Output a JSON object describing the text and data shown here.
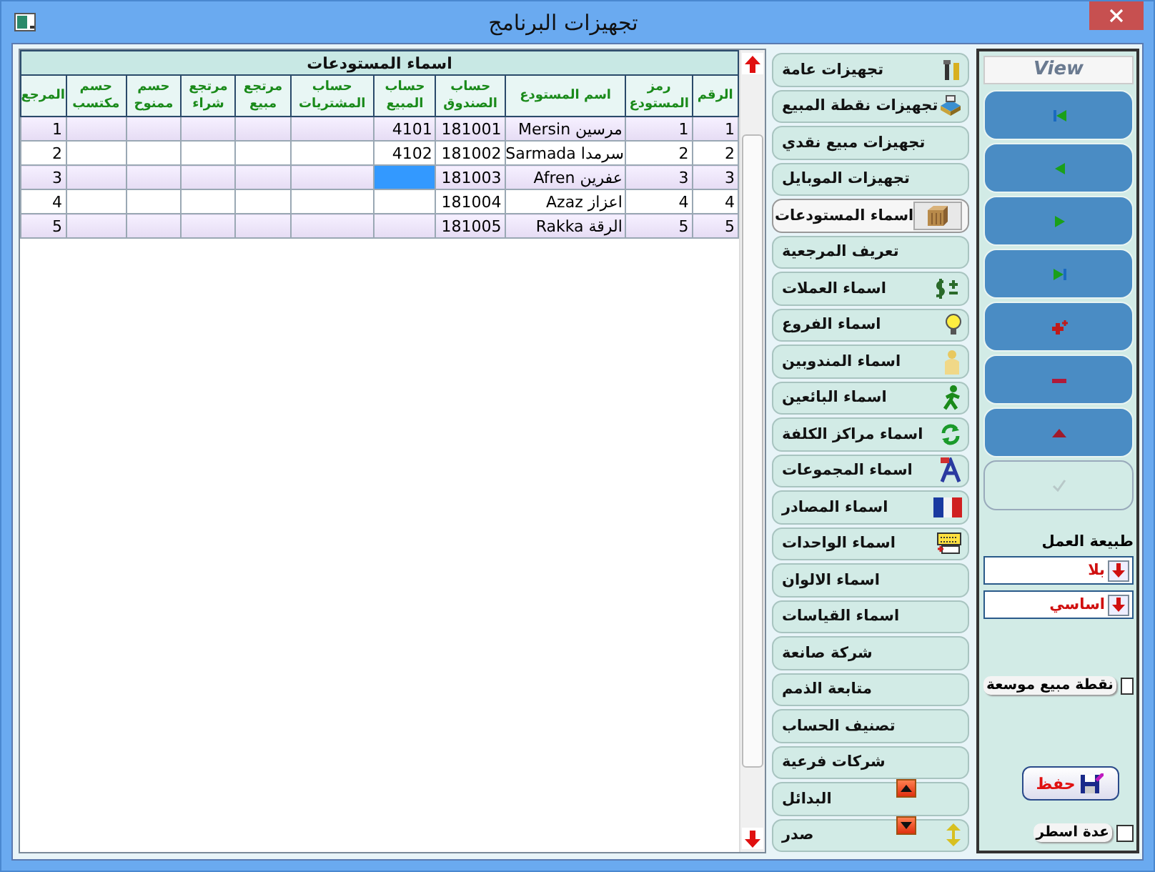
{
  "window": {
    "title": "تجهيزات البرنامج"
  },
  "table": {
    "title": "اسماء المستودعات",
    "columns": [
      "الرقم",
      "رمز المستودع",
      "اسم المستودع",
      "حساب الصندوق",
      "حساب المبيع",
      "حساب المشتريات",
      "مرتجع مبيع",
      "مرتجع شراء",
      "حسم ممنوح",
      "حسم مكتسب",
      "المرجع"
    ],
    "rows": [
      {
        "cells": [
          {
            "text": "1",
            "selected": false
          },
          {
            "text": "1",
            "selected": false
          },
          {
            "text": "مرسين Mersin",
            "selected": false
          },
          {
            "text": "181001",
            "selected": false
          },
          {
            "text": "4101",
            "selected": false
          },
          {
            "selected": false
          },
          {
            "selected": false
          },
          {
            "selected": false
          },
          {
            "selected": false
          },
          {
            "selected": false
          },
          {
            "text": "1",
            "selected": false
          }
        ]
      },
      {
        "cells": [
          {
            "text": "2",
            "selected": false
          },
          {
            "text": "2",
            "selected": false
          },
          {
            "text": "سرمدا Sarmada",
            "selected": false
          },
          {
            "text": "181002",
            "selected": false
          },
          {
            "text": "4102",
            "selected": false
          },
          {
            "selected": false
          },
          {
            "selected": false
          },
          {
            "selected": false
          },
          {
            "selected": false
          },
          {
            "selected": false
          },
          {
            "text": "2",
            "selected": false
          }
        ]
      },
      {
        "cells": [
          {
            "text": "3",
            "selected": false
          },
          {
            "text": "3",
            "selected": false
          },
          {
            "text": "عفرين Afren",
            "selected": false
          },
          {
            "text": "181003",
            "selected": false
          },
          {
            "selected": true
          },
          {
            "selected": false
          },
          {
            "selected": false
          },
          {
            "selected": false
          },
          {
            "selected": false
          },
          {
            "selected": false
          },
          {
            "text": "3",
            "selected": false
          }
        ]
      },
      {
        "cells": [
          {
            "text": "4",
            "selected": false
          },
          {
            "text": "4",
            "selected": false
          },
          {
            "text": "اعزاز Azaz",
            "selected": false
          },
          {
            "text": "181004",
            "selected": false
          },
          {
            "selected": false
          },
          {
            "selected": false
          },
          {
            "selected": false
          },
          {
            "selected": false
          },
          {
            "selected": false
          },
          {
            "selected": false
          },
          {
            "text": "4",
            "selected": false
          }
        ]
      },
      {
        "cells": [
          {
            "text": "5",
            "selected": false
          },
          {
            "text": "5",
            "selected": false
          },
          {
            "text": "الرقة Rakka",
            "selected": false
          },
          {
            "text": "181005",
            "selected": false
          },
          {
            "selected": false
          },
          {
            "selected": false
          },
          {
            "selected": false
          },
          {
            "selected": false
          },
          {
            "selected": false
          },
          {
            "selected": false
          },
          {
            "text": "5",
            "selected": false
          }
        ]
      }
    ]
  },
  "menu": {
    "items": [
      {
        "label": "تجهيزات عامة",
        "kind": "tools",
        "selected": false
      },
      {
        "label": "تجهيزات نقطة المبيع",
        "kind": "register",
        "selected": false
      },
      {
        "label": "تجهيزات مبيع نقدي",
        "kind": "plain",
        "selected": false
      },
      {
        "label": "تجهيزات الموبايل",
        "kind": "plain",
        "selected": false
      },
      {
        "label": "اسماء المستودعات",
        "kind": "box",
        "selected": true
      },
      {
        "label": "تعريف المرجعية",
        "kind": "plain",
        "selected": false
      },
      {
        "label": "اسماء العملات",
        "kind": "money",
        "selected": false
      },
      {
        "label": "اسماء الفروع",
        "kind": "bulb",
        "selected": false
      },
      {
        "label": "اسماء المندوبين",
        "kind": "person",
        "selected": false
      },
      {
        "label": "اسماء البائعين",
        "kind": "runner",
        "selected": false
      },
      {
        "label": "اسماء مراكز الكلفة",
        "kind": "refresh",
        "selected": false
      },
      {
        "label": "اسماء المجموعات",
        "kind": "font",
        "selected": false
      },
      {
        "label": "اسماء المصادر",
        "kind": "flag",
        "selected": false
      },
      {
        "label": "اسماء الواحدات",
        "kind": "keyboard",
        "selected": false
      },
      {
        "label": "اسماء الالوان",
        "kind": "plain",
        "selected": false
      },
      {
        "label": "اسماء القياسات",
        "kind": "plain",
        "selected": false
      },
      {
        "label": "شركة صانعة",
        "kind": "plain",
        "selected": false
      },
      {
        "label": "متابعة الذمم",
        "kind": "plain",
        "selected": false
      },
      {
        "label": "تصنيف الحساب",
        "kind": "plain",
        "selected": false
      },
      {
        "label": "شركات فرعية",
        "kind": "plain",
        "selected": false
      },
      {
        "label": "البدائل",
        "kind": "plain",
        "selected": false
      },
      {
        "label": "صدر",
        "kind": "arrows",
        "selected": false
      }
    ]
  },
  "panel": {
    "header": "View",
    "nav_buttons": [
      {
        "kind": "first",
        "disabled": false
      },
      {
        "kind": "prev",
        "disabled": false
      },
      {
        "kind": "next",
        "disabled": false
      },
      {
        "kind": "last",
        "disabled": false
      },
      {
        "kind": "add",
        "disabled": false
      },
      {
        "kind": "delete",
        "disabled": false
      },
      {
        "kind": "up",
        "disabled": false
      },
      {
        "kind": "confirm",
        "disabled": true
      }
    ],
    "work_type_label": "طبيعة العمل",
    "dropdowns": [
      {
        "value": "بلا"
      },
      {
        "value": "اساسي"
      }
    ],
    "extended_pos": {
      "label": "نقطة مبيع موسعة",
      "checked": false
    },
    "save_button": "حفظ",
    "multi_line": {
      "label": "عدة اسطر",
      "checked": false
    }
  }
}
